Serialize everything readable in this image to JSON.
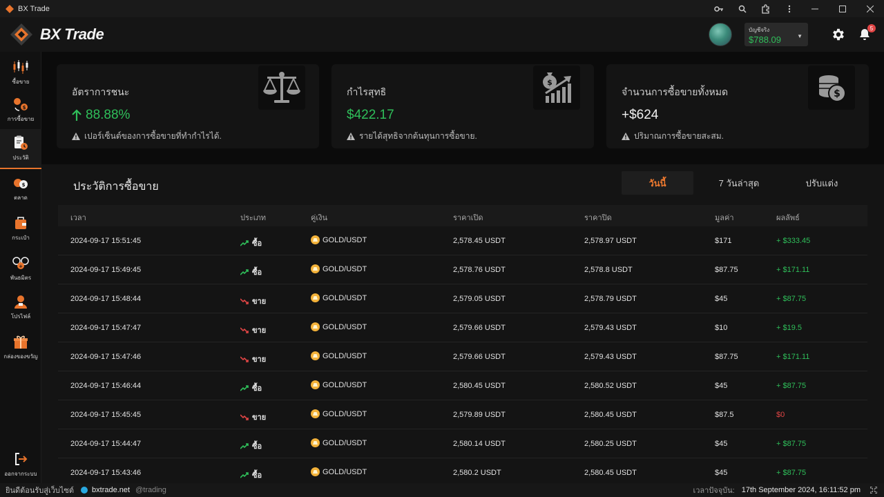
{
  "window": {
    "title": "BX Trade"
  },
  "header": {
    "logo_text": "BX Trade",
    "balance_label": "บัญชีจริง",
    "balance_value": "$788.09",
    "notification_count": "5"
  },
  "sidebar": {
    "items": [
      {
        "label": "ซื้อขาย",
        "icon": "candlestick-icon"
      },
      {
        "label": "การซื้อขาย",
        "icon": "coins-exchange-icon"
      },
      {
        "label": "ประวัติ",
        "icon": "clipboard-clock-icon",
        "active": true
      },
      {
        "label": "ตลาด",
        "icon": "market-icon"
      },
      {
        "label": "กระเป๋า",
        "icon": "wallet-icon"
      },
      {
        "label": "พันธมิตร",
        "icon": "partners-icon"
      },
      {
        "label": "โปรไฟล์",
        "icon": "profile-icon"
      },
      {
        "label": "กล่องของขวัญ",
        "icon": "gift-box-icon"
      },
      {
        "label": "ออกจากระบบ",
        "icon": "logout-icon"
      }
    ]
  },
  "stats": [
    {
      "title": "อัตราการชนะ",
      "value": "88.88%",
      "note": "เปอร์เซ็นต์ของการซื้อขายที่ทำกำไรได้.",
      "icon": "scale-icon",
      "color": "#2fbf5a"
    },
    {
      "title": "กำไรสุทธิ",
      "value": "$422.17",
      "note": "รายได้สุทธิจากต้นทุนการซื้อขาย.",
      "icon": "money-growth-icon",
      "color": "#2fbf5a"
    },
    {
      "title": "จำนวนการซื้อขายทั้งหมด",
      "value": "+$624",
      "note": "ปริมาณการซื้อขายสะสม.",
      "icon": "coin-stack-icon",
      "color": "#f0f0f0"
    }
  ],
  "history": {
    "title": "ประวัติการซื้อขาย",
    "tabs": [
      "วันนี้",
      "7 วันล่าสุด",
      "ปรับแต่ง"
    ],
    "columns": [
      "เวลา",
      "ประเภท",
      "คู่เงิน",
      "ราคาเปิด",
      "ราคาปิด",
      "มูลค่า",
      "ผลลัพธ์"
    ],
    "rows": [
      {
        "time": "2024-09-17 15:51:45",
        "type": "ซื้อ",
        "dir": "up",
        "pair": "GOLD/USDT",
        "open": "2,578.45 USDT",
        "close": "2,578.97 USDT",
        "amount": "$171",
        "result": "+ $333.45",
        "positive": true
      },
      {
        "time": "2024-09-17 15:49:45",
        "type": "ซื้อ",
        "dir": "up",
        "pair": "GOLD/USDT",
        "open": "2,578.76 USDT",
        "close": "2,578.8 USDT",
        "amount": "$87.75",
        "result": "+ $171.11",
        "positive": true
      },
      {
        "time": "2024-09-17 15:48:44",
        "type": "ขาย",
        "dir": "down",
        "pair": "GOLD/USDT",
        "open": "2,579.05 USDT",
        "close": "2,578.79 USDT",
        "amount": "$45",
        "result": "+ $87.75",
        "positive": true
      },
      {
        "time": "2024-09-17 15:47:47",
        "type": "ขาย",
        "dir": "down",
        "pair": "GOLD/USDT",
        "open": "2,579.66 USDT",
        "close": "2,579.43 USDT",
        "amount": "$10",
        "result": "+ $19.5",
        "positive": true
      },
      {
        "time": "2024-09-17 15:47:46",
        "type": "ขาย",
        "dir": "down",
        "pair": "GOLD/USDT",
        "open": "2,579.66 USDT",
        "close": "2,579.43 USDT",
        "amount": "$87.75",
        "result": "+ $171.11",
        "positive": true
      },
      {
        "time": "2024-09-17 15:46:44",
        "type": "ซื้อ",
        "dir": "up",
        "pair": "GOLD/USDT",
        "open": "2,580.45 USDT",
        "close": "2,580.52 USDT",
        "amount": "$45",
        "result": "+ $87.75",
        "positive": true
      },
      {
        "time": "2024-09-17 15:45:45",
        "type": "ขาย",
        "dir": "down",
        "pair": "GOLD/USDT",
        "open": "2,579.89 USDT",
        "close": "2,580.45 USDT",
        "amount": "$87.5",
        "result": "$0",
        "positive": false
      },
      {
        "time": "2024-09-17 15:44:47",
        "type": "ซื้อ",
        "dir": "up",
        "pair": "GOLD/USDT",
        "open": "2,580.14 USDT",
        "close": "2,580.25 USDT",
        "amount": "$45",
        "result": "+ $87.75",
        "positive": true
      },
      {
        "time": "2024-09-17 15:43:46",
        "type": "ซื้อ",
        "dir": "up",
        "pair": "GOLD/USDT",
        "open": "2,580.2 USDT",
        "close": "2,580.45 USDT",
        "amount": "$45",
        "result": "+ $87.75",
        "positive": true
      }
    ]
  },
  "statusbar": {
    "welcome": "ยินดีต้อนรับสู่เว็บไซต์",
    "site": "bxtrade.net",
    "handle": "@trading",
    "time_label": "เวลาปัจจุบัน:",
    "time_value": "17th September 2024, 16:11:52 pm"
  },
  "colors": {
    "accent": "#f07a2f",
    "positive": "#2fbf5a",
    "negative": "#e04545"
  }
}
